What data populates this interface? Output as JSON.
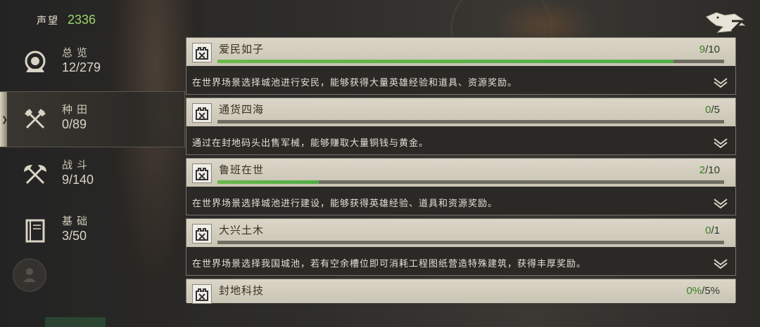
{
  "header": {
    "reputation_label": "声望",
    "reputation_value": "2336"
  },
  "sidebar": {
    "items": [
      {
        "title": "总览",
        "count": "12/279",
        "icon": "overview-icon",
        "active": false
      },
      {
        "title": "种田",
        "count": "0/89",
        "icon": "crossed-axes-icon",
        "active": true
      },
      {
        "title": "战斗",
        "count": "9/140",
        "icon": "crossed-battle-axes-icon",
        "active": false
      },
      {
        "title": "基础",
        "count": "3/50",
        "icon": "book-icon",
        "active": false
      }
    ]
  },
  "tasks": [
    {
      "title": "爱民如子",
      "done": "9",
      "total": "/10",
      "progress": 0.9,
      "desc": "在世界场景选择城池进行安民，能够获得大量英雄经验和道具、资源奖励。"
    },
    {
      "title": "通货四海",
      "done": "0",
      "total": "/5",
      "progress": 0.0,
      "desc": "通过在封地码头出售军械，能够赚取大量铜钱与黄金。"
    },
    {
      "title": "鲁班在世",
      "done": "2",
      "total": "/10",
      "progress": 0.2,
      "desc": "在世界场景选择城池进行建设，能够获得英雄经验、道具和资源奖励。"
    },
    {
      "title": "大兴土木",
      "done": "0",
      "total": "/1",
      "progress": 0.0,
      "desc": "在世界场景选择我国城池，若有空余槽位即可消耗工程图纸营造特殊建筑，获得丰厚奖励。"
    },
    {
      "title": "封地科技",
      "done": "0%",
      "total": "/5%",
      "progress": 0.0,
      "desc": ""
    }
  ],
  "colors": {
    "accent_green": "#9ed36a",
    "progress_fill": "#5bb34a",
    "panel_head": "#d3cebf"
  }
}
